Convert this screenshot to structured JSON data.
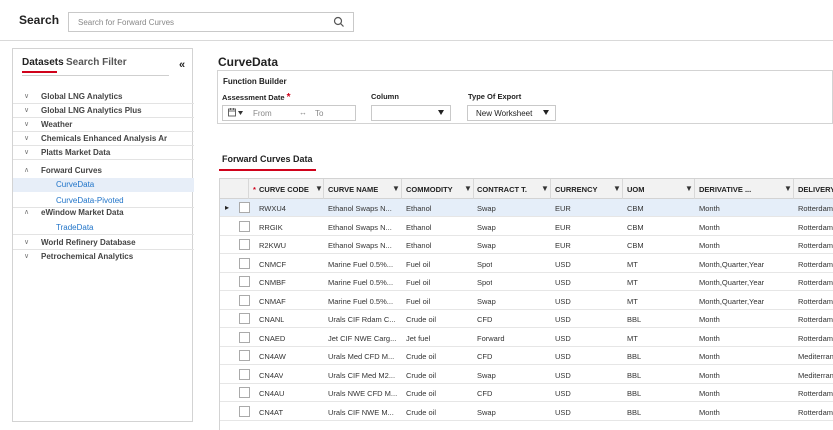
{
  "search": {
    "label": "Search",
    "placeholder": "Search for Forward Curves"
  },
  "left": {
    "tab_datasets": "Datasets",
    "tab_filter": "Search Filter",
    "collapse_glyph": "«",
    "tree": [
      {
        "label": "Global LNG Analytics",
        "expanded": false
      },
      {
        "label": "Global LNG Analytics Plus",
        "expanded": false
      },
      {
        "label": "Weather",
        "expanded": false
      },
      {
        "label": "Chemicals Enhanced Analysis Ar",
        "expanded": false
      },
      {
        "label": "Platts Market Data",
        "expanded": false
      },
      {
        "label": "Forward Curves",
        "expanded": true
      },
      {
        "label": "CurveData",
        "child": true,
        "active": true
      },
      {
        "label": "CurveData-Pivoted",
        "child": true
      },
      {
        "label": "eWindow Market Data",
        "expanded": true
      },
      {
        "label": "TradeData",
        "child": true
      },
      {
        "label": "World Refinery Database",
        "expanded": false
      },
      {
        "label": "Petrochemical Analytics",
        "expanded": false
      }
    ]
  },
  "main": {
    "title": "CurveData",
    "function_builder": {
      "heading": "Function Builder",
      "assessment_label": "Assessment Date",
      "required_mark": "*",
      "from_placeholder": "From",
      "to_placeholder": "To",
      "arrow": "↔",
      "column_label": "Column",
      "column_value": "",
      "export_label": "Type Of Export",
      "export_value": "New Worksheet"
    },
    "section_tab": "Forward Curves Data",
    "grid": {
      "columns": [
        "CURVE CODE",
        "CURVE NAME",
        "COMMODITY",
        "CONTRACT T...",
        "CURRENCY",
        "UOM",
        "DERIVATIVE ...",
        "DELIVERY R..."
      ],
      "required_column_mark": "*",
      "filter_glyph": "▼",
      "rows": [
        [
          "RWXU4",
          "Ethanol Swaps N...",
          "Ethanol",
          "Swap",
          "EUR",
          "CBM",
          "Month",
          "Rotterdam"
        ],
        [
          "RRGIK",
          "Ethanol Swaps N...",
          "Ethanol",
          "Swap",
          "EUR",
          "CBM",
          "Month",
          "Rotterdam"
        ],
        [
          "R2KWU",
          "Ethanol Swaps N...",
          "Ethanol",
          "Swap",
          "EUR",
          "CBM",
          "Month",
          "Rotterdam"
        ],
        [
          "CNMCF",
          "Marine Fuel 0.5%...",
          "Fuel oil",
          "Spot",
          "USD",
          "MT",
          "Month,Quarter,Year",
          "Rotterdam"
        ],
        [
          "CNMBF",
          "Marine Fuel 0.5%...",
          "Fuel oil",
          "Spot",
          "USD",
          "MT",
          "Month,Quarter,Year",
          "Rotterdam"
        ],
        [
          "CNMAF",
          "Marine Fuel 0.5%...",
          "Fuel oil",
          "Swap",
          "USD",
          "MT",
          "Month,Quarter,Year",
          "Rotterdam"
        ],
        [
          "CNANL",
          "Urals CIF Rdam C...",
          "Crude oil",
          "CFD",
          "USD",
          "BBL",
          "Month",
          "Rotterdam"
        ],
        [
          "CNAED",
          "Jet CIF NWE Carg...",
          "Jet fuel",
          "Forward",
          "USD",
          "MT",
          "Month",
          "Rotterdam"
        ],
        [
          "CN4AW",
          "Urals Med CFD M...",
          "Crude oil",
          "CFD",
          "USD",
          "BBL",
          "Month",
          "Mediterranean"
        ],
        [
          "CN4AV",
          "Urals CIF Med M2...",
          "Crude oil",
          "Swap",
          "USD",
          "BBL",
          "Month",
          "Mediterranean"
        ],
        [
          "CN4AU",
          "Urals NWE CFD M...",
          "Crude oil",
          "CFD",
          "USD",
          "BBL",
          "Month",
          "Rotterdam"
        ],
        [
          "CN4AT",
          "Urals CIF NWE M...",
          "Crude oil",
          "Swap",
          "USD",
          "BBL",
          "Month",
          "Rotterdam"
        ]
      ],
      "selected_row": 0,
      "row_pointer": "▸"
    }
  },
  "colors": {
    "accent_red": "#d0021b",
    "link_blue": "#1f73c8",
    "selected_row": "#e5eef9"
  }
}
